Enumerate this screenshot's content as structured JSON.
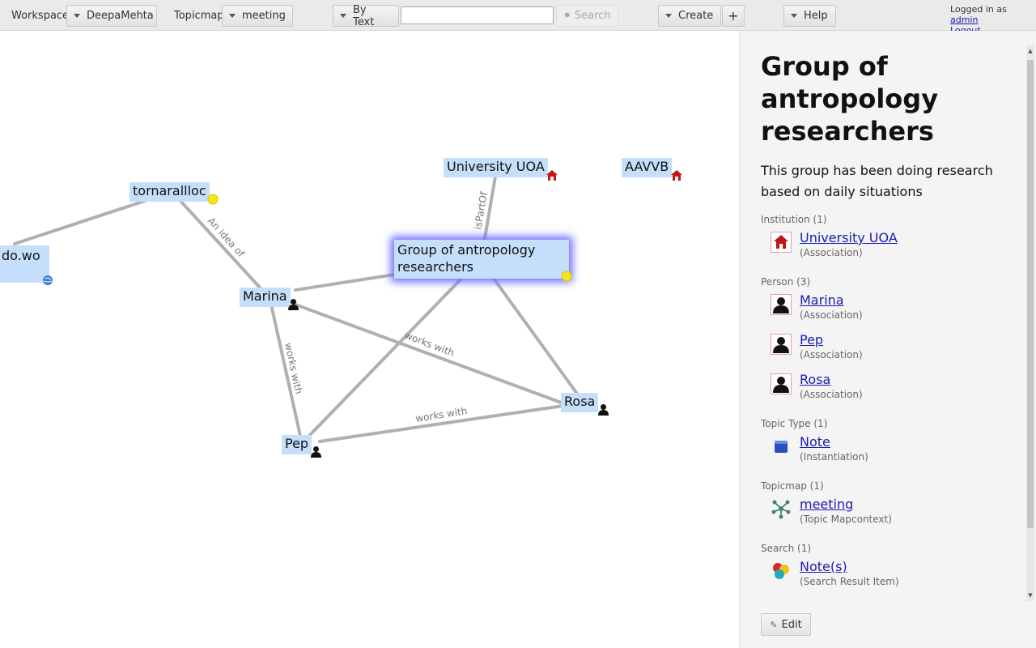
{
  "toolbar": {
    "workspace_label": "Workspace",
    "workspace_value": "DeepaMehta",
    "topicmap_label": "Topicmap",
    "topicmap_value": "meeting",
    "search_mode": "By Text",
    "search_placeholder": "",
    "search_button": "Search",
    "create_button": "Create",
    "plus_button": "+",
    "help_button": "Help",
    "login_prefix": "Logged in as",
    "login_user": "admin",
    "logout_link": "Logout"
  },
  "canvas": {
    "nodes": {
      "dowo": "do.wo",
      "tornarallloc": "tornarallloc",
      "university": "University UOA",
      "aavvb": "AAVVB",
      "group_line1": "Group of antropology",
      "group_line2": "researchers",
      "marina": "Marina",
      "rosa": "Rosa",
      "pep": "Pep"
    },
    "edges": {
      "idea": "An idea of",
      "ispartof": "isPartOf",
      "works1": "works with",
      "works2": "works with",
      "works3": "works with"
    },
    "colors": {
      "node_bg": "#c5defa",
      "edge": "#b0b0b0",
      "selection_glow": "#6a6aff"
    }
  },
  "panel": {
    "title": "Group of antropology researchers",
    "description": "This group has been doing research based on daily situations",
    "groups": [
      {
        "heading": "Institution (1)",
        "items": [
          {
            "name": "University UOA",
            "sub": "(Association)",
            "icon": "institution-icon"
          }
        ]
      },
      {
        "heading": "Person (3)",
        "items": [
          {
            "name": "Marina",
            "sub": "(Association)",
            "icon": "person-icon"
          },
          {
            "name": "Pep",
            "sub": "(Association)",
            "icon": "person-icon"
          },
          {
            "name": "Rosa",
            "sub": "(Association)",
            "icon": "person-icon"
          }
        ]
      },
      {
        "heading": "Topic Type (1)",
        "items": [
          {
            "name": "Note",
            "sub": "(Instantiation)",
            "icon": "note-icon"
          }
        ]
      },
      {
        "heading": "Topicmap (1)",
        "items": [
          {
            "name": "meeting",
            "sub": "(Topic Mapcontext)",
            "icon": "topicmap-icon"
          }
        ]
      },
      {
        "heading": "Search (1)",
        "items": [
          {
            "name": "Note(s)",
            "sub": "(Search Result Item)",
            "icon": "search-result-icon"
          }
        ]
      }
    ],
    "edit_button": "Edit"
  }
}
